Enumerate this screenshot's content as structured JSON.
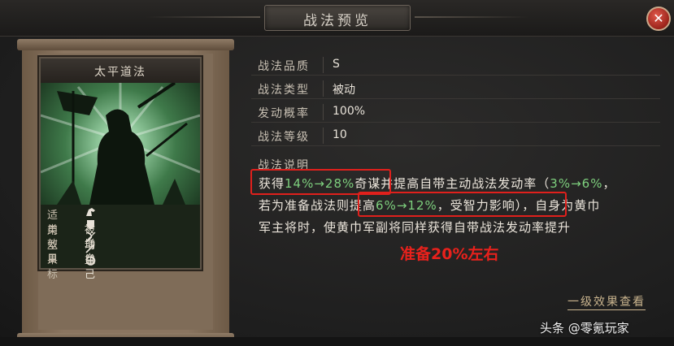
{
  "window": {
    "title": "战法预览",
    "close_glyph": "✕"
  },
  "card": {
    "name": "太平道法",
    "stats": [
      {
        "key": "适用",
        "value": "",
        "icons": [
          "cavalry-icon",
          "shield-icon",
          "bow-icon",
          "spear-icon",
          "wheel-icon"
        ]
      },
      {
        "key": "类型",
        "value": "被动"
      },
      {
        "key": "效果",
        "value": "增益"
      },
      {
        "key": "目标",
        "value": "自己"
      }
    ]
  },
  "info": {
    "rows": [
      {
        "key": "战法品质",
        "value": "S"
      },
      {
        "key": "战法类型",
        "value": "被动"
      },
      {
        "key": "发动概率",
        "value": "100%"
      },
      {
        "key": "战法等级",
        "value": "10"
      }
    ],
    "description_title": "战法说明",
    "line1": {
      "a": "获得",
      "b": "14%→28%",
      "c": "奇谋",
      "d": "并提高自带主动战法发动率（",
      "e": "3%→6%",
      "f": "，"
    },
    "line2": {
      "a": "若为准备战法则",
      "b": "提高",
      "c": "6%→12%",
      "d": "，受智力影响）",
      "e": "，自身为黄巾"
    },
    "line3": "军主将时，使黄巾军副将同样获得自带战法发动率提升"
  },
  "annotation": "准备20%左右",
  "effects_link": "一级效果查看",
  "watermark": "头条 @零氪玩家",
  "colors": {
    "highlight_green": "#7ed07e",
    "annotation_red": "#e0201c",
    "close_red": "#c0392b"
  }
}
